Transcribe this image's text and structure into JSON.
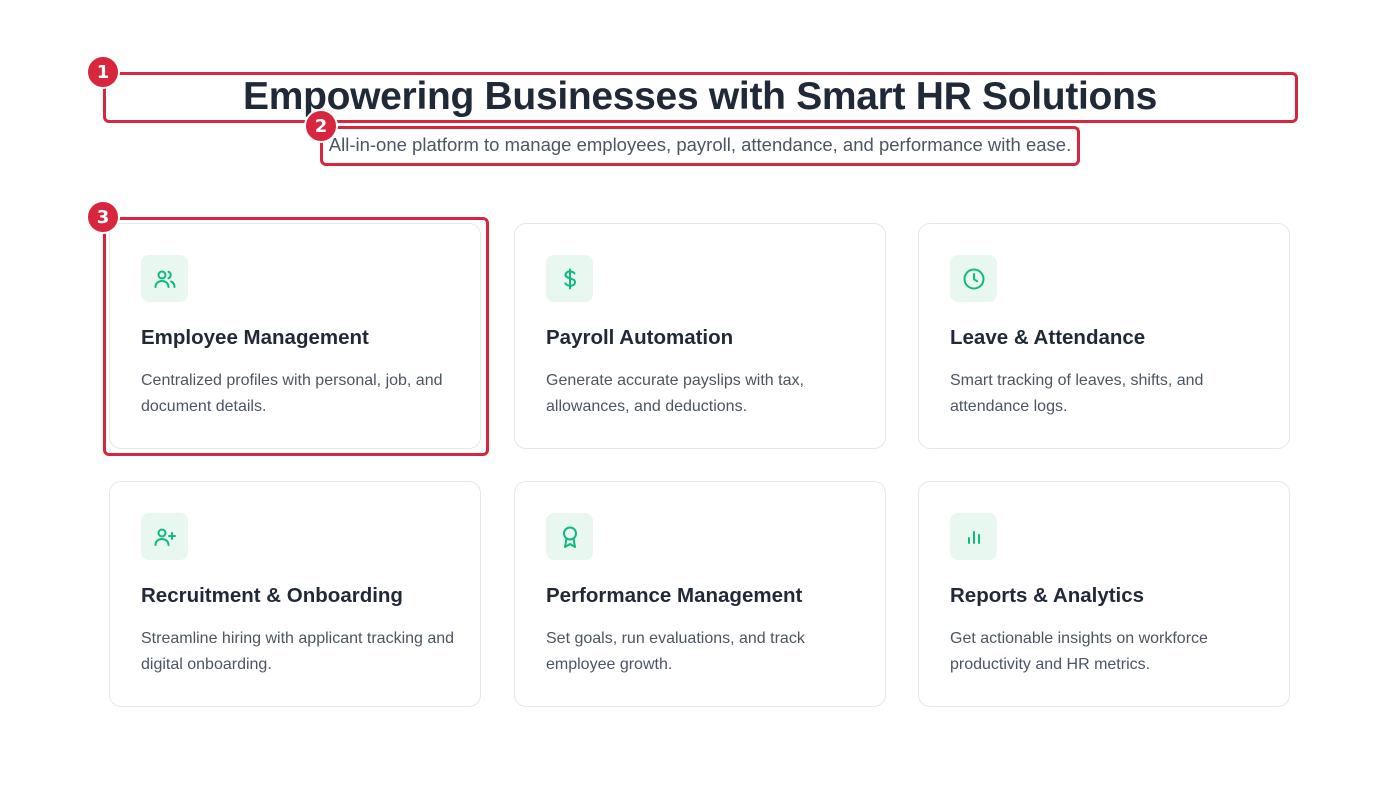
{
  "hero": {
    "title": "Empowering Businesses with Smart HR Solutions",
    "subtitle": "All-in-one platform to manage employees, payroll, attendance, and performance with ease."
  },
  "features": [
    {
      "icon": "users-icon",
      "title": "Employee Management",
      "description": "Centralized profiles with personal, job, and document details."
    },
    {
      "icon": "dollar-icon",
      "title": "Payroll Automation",
      "description": "Generate accurate payslips with tax, allowances, and deductions."
    },
    {
      "icon": "clock-icon",
      "title": "Leave & Attendance",
      "description": "Smart tracking of leaves, shifts, and attendance logs."
    },
    {
      "icon": "user-plus-icon",
      "title": "Recruitment & Onboarding",
      "description": "Streamline hiring with applicant tracking and digital onboarding."
    },
    {
      "icon": "award-icon",
      "title": "Performance Management",
      "description": "Set goals, run evaluations, and track employee growth."
    },
    {
      "icon": "bar-chart-icon",
      "title": "Reports & Analytics",
      "description": "Get actionable insights on workforce productivity and HR metrics."
    }
  ],
  "annotations": [
    {
      "label": "1"
    },
    {
      "label": "2"
    },
    {
      "label": "3"
    }
  ],
  "colors": {
    "accent": "#10b981",
    "icon_bg": "#e8f8f0",
    "annotation": "#d7263d",
    "title": "#1f2937",
    "text": "#4b5563",
    "card_border": "#e5e7eb"
  }
}
